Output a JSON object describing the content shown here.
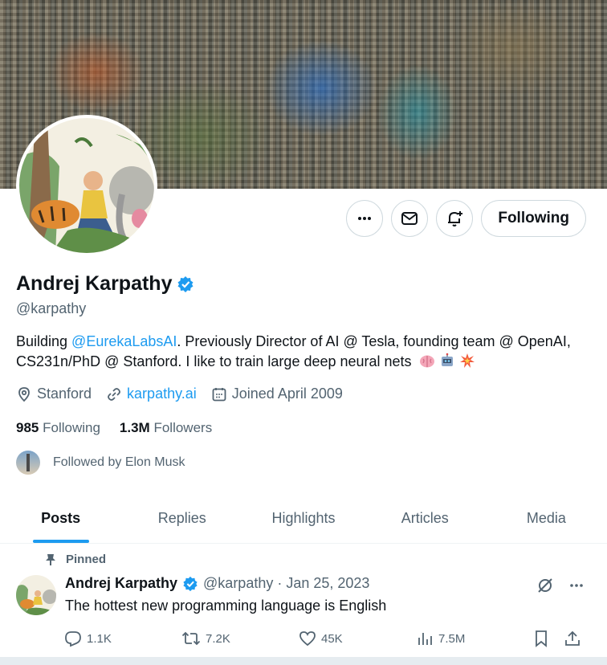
{
  "profile": {
    "name": "Andrej Karpathy",
    "handle": "@karpathy",
    "bio_prefix": "Building ",
    "bio_link": "@EurekaLabsAI",
    "bio_rest": ". Previously Director of AI @ Tesla, founding team @ OpenAI, CS231n/PhD @ Stanford. I like to train large deep neural nets",
    "bio_emojis": [
      "brain-emoji",
      "robot-emoji",
      "collision-emoji"
    ],
    "location": "Stanford",
    "website": "karpathy.ai",
    "joined": "Joined April 2009",
    "following_count": "985",
    "following_label": "Following",
    "followers_count": "1.3M",
    "followers_label": "Followers",
    "followed_by": "Followed by Elon Musk"
  },
  "actions": {
    "follow_label": "Following",
    "icons": [
      "more-icon",
      "message-icon",
      "notifications-add-icon"
    ]
  },
  "tabs": [
    {
      "label": "Posts",
      "active": true
    },
    {
      "label": "Replies",
      "active": false
    },
    {
      "label": "Highlights",
      "active": false
    },
    {
      "label": "Articles",
      "active": false
    },
    {
      "label": "Media",
      "active": false
    }
  ],
  "tweet": {
    "pinned_label": "Pinned",
    "author": "Andrej Karpathy",
    "meta": "@karpathy · Jan 25, 2023",
    "text": "The hottest new programming language is English",
    "replies": "1.1K",
    "reposts": "7.2K",
    "likes": "45K",
    "views": "7.5M"
  },
  "colors": {
    "accent": "#1d9bf0",
    "text": "#0f1419",
    "secondary": "#536471",
    "border": "#cfd9de"
  }
}
